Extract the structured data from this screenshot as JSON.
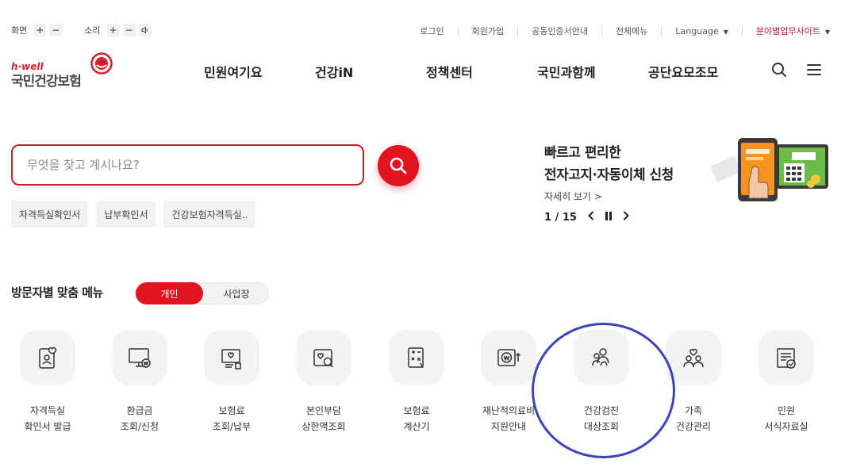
{
  "utility": {
    "screen_label": "화면",
    "sound_label": "소리",
    "plus": "+",
    "minus": "−",
    "links": [
      "로그인",
      "회원가입",
      "공동인증서안내",
      "전체메뉴"
    ],
    "language": "Language",
    "affiliated": "분야별업무사이트"
  },
  "logo": {
    "small": "h·well",
    "main": "국민건강보험"
  },
  "gnb": [
    "민원여기요",
    "건강iN",
    "정책센터",
    "국민과함께",
    "공단요모조모"
  ],
  "search": {
    "placeholder": "무엇을 찾고 계시나요?",
    "chips": [
      "자격득실확인서",
      "납부확인서",
      "건강보험자격득실.."
    ]
  },
  "banner": {
    "line1": "빠르고 편리한",
    "line2": "전자고지·자동이체 신청",
    "link": "자세히 보기 >",
    "pager": "1 / 15"
  },
  "visitor": {
    "title": "방문자별 맞춤 메뉴",
    "tab_personal": "개인",
    "tab_business": "사업장",
    "items": [
      {
        "line1": "자격득실",
        "line2": "확인서 발급"
      },
      {
        "line1": "환급금",
        "line2": "조회/신청"
      },
      {
        "line1": "보험료",
        "line2": "조회/납부"
      },
      {
        "line1": "본인부담",
        "line2": "상한액조회"
      },
      {
        "line1": "보험료",
        "line2": "계산기"
      },
      {
        "line1": "재난적의료비",
        "line2": "지원안내"
      },
      {
        "line1": "건강검진",
        "line2": "대상조회"
      },
      {
        "line1": "가족",
        "line2": "건강관리"
      },
      {
        "line1": "민원",
        "line2": "서식자료실"
      }
    ]
  },
  "colors": {
    "brand_red": "#e2121f",
    "annotation_blue": "#3b44b8"
  }
}
